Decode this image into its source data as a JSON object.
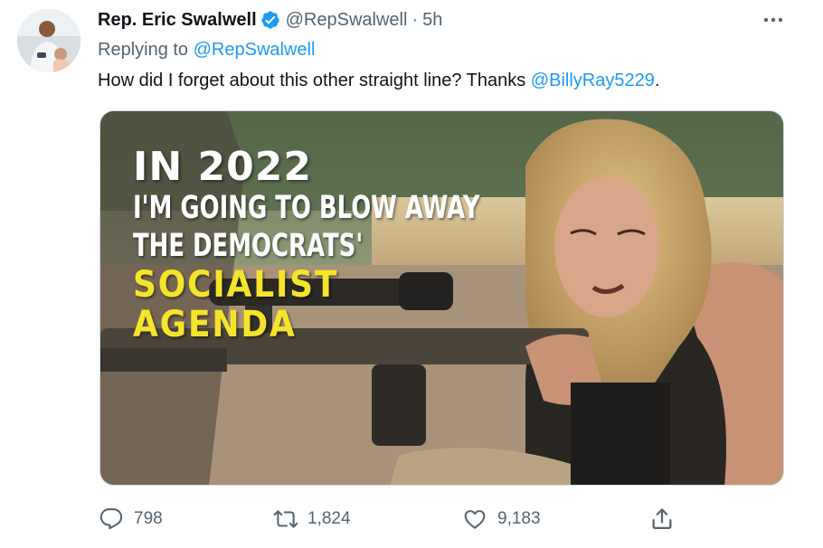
{
  "author": {
    "display_name": "Rep. Eric Swalwell",
    "handle": "@RepSwalwell",
    "separator": "·",
    "time": "5h"
  },
  "reply": {
    "prefix": "Replying to ",
    "target": "@RepSwalwell"
  },
  "tweet": {
    "text_before": "How did I forget about this other straight line? Thanks ",
    "mention": "@BillyRay5229",
    "text_after": "."
  },
  "media": {
    "overlay_line1": "IN 2022",
    "overlay_line2": "I'M GOING TO BLOW AWAY",
    "overlay_line3": "THE DEMOCRATS'",
    "overlay_line4": "SOCIALIST",
    "overlay_line5": "AGENDA"
  },
  "actions": {
    "replies": "798",
    "retweets": "1,824",
    "likes": "9,183"
  },
  "icons": {
    "verified": "verified-badge-icon",
    "more": "more-options-icon",
    "reply": "reply-icon",
    "retweet": "retweet-icon",
    "like": "like-icon",
    "share": "share-icon"
  },
  "colors": {
    "link": "#1d9bf0",
    "muted": "#536471",
    "text": "#0f1419",
    "overlay_yellow": "#f5e52a"
  }
}
